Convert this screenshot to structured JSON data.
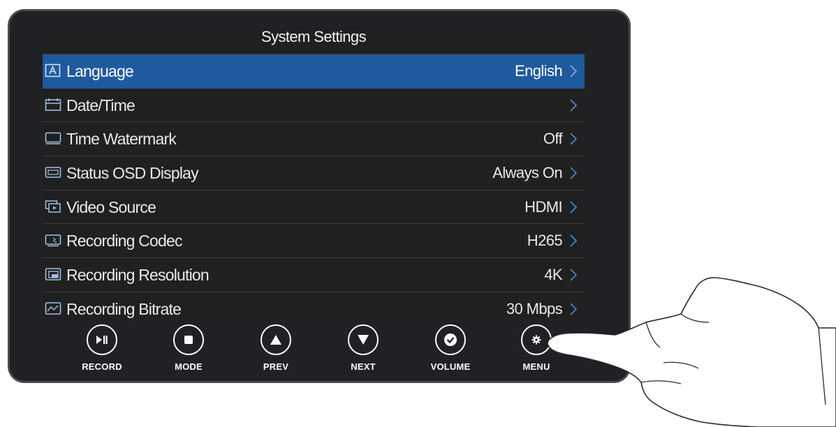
{
  "screen": {
    "title": "System Settings",
    "rows": [
      {
        "label": "Language",
        "value": "English",
        "icon": "language-icon",
        "selected": true
      },
      {
        "label": "Date/Time",
        "value": "",
        "icon": "calendar-icon",
        "selected": false
      },
      {
        "label": "Time Watermark",
        "value": "Off",
        "icon": "watermark-icon",
        "selected": false
      },
      {
        "label": "Status OSD Display",
        "value": "Always On",
        "icon": "osd-icon",
        "selected": false
      },
      {
        "label": "Video Source",
        "value": "HDMI",
        "icon": "video-source-icon",
        "selected": false
      },
      {
        "label": "Recording Codec",
        "value": "H265",
        "icon": "codec-icon",
        "selected": false
      },
      {
        "label": "Recording Resolution",
        "value": "4K",
        "icon": "resolution-icon",
        "selected": false
      },
      {
        "label": "Recording Bitrate",
        "value": "30 Mbps",
        "icon": "bitrate-icon",
        "selected": false
      }
    ]
  },
  "hardware_buttons": [
    {
      "label": "RECORD",
      "icon": "play-pause-icon"
    },
    {
      "label": "MODE",
      "icon": "stop-square-icon"
    },
    {
      "label": "PREV",
      "icon": "triangle-up-icon"
    },
    {
      "label": "NEXT",
      "icon": "triangle-down-icon"
    },
    {
      "label": "VOLUME",
      "icon": "check-icon"
    },
    {
      "label": "MENU",
      "icon": "gear-icon"
    }
  ],
  "colors": {
    "device_body": "#202124",
    "device_border": "#4a4a4f",
    "selected_row": "#1f5a9e",
    "text": "#e9e9e9"
  }
}
